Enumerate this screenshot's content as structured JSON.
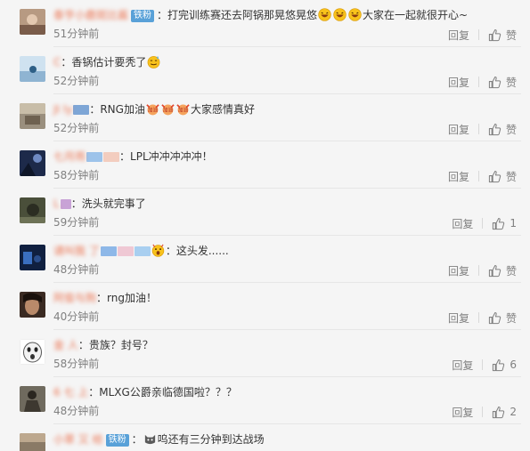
{
  "comments": [
    {
      "nick": "泰亨小鹿斑比酱",
      "badge": "铁粉",
      "text": "：打完训练赛还去阿锅那晃悠晃悠",
      "emojis": [
        "laugh",
        "laugh",
        "laugh"
      ],
      "text2": "大家在一起就很开心~",
      "time": "51分钟前",
      "reply": "回复",
      "like": "赞",
      "likes": ""
    },
    {
      "nick": "C ",
      "badge": "",
      "text": "：香锅估计要秃了",
      "emojis": [
        "sweat"
      ],
      "text2": "",
      "time": "52分钟前",
      "reply": "回复",
      "like": "赞",
      "likes": ""
    },
    {
      "nick": "JI  ly",
      "badge": "",
      "text": "：RNG加油",
      "emojis": [
        "cheer",
        "cheer",
        "cheer"
      ],
      "text2": "大家感情真好",
      "time": "52分钟前",
      "reply": "回复",
      "like": "赞",
      "likes": ""
    },
    {
      "nick": "七月雨",
      "badge": "",
      "text": "：LPL冲冲冲冲冲！",
      "emojis": [],
      "text2": "",
      "time": "58分钟前",
      "reply": "回复",
      "like": "赞",
      "likes": ""
    },
    {
      "nick": "L  ",
      "badge": "",
      "text": "：洗头就完事了",
      "emojis": [],
      "text2": "",
      "time": "59分钟前",
      "reply": "回复",
      "like": "",
      "likes": "1"
    },
    {
      "nick": "请叫我  了",
      "badge": "",
      "text": "：这头发......",
      "emojis": [
        "shock"
      ],
      "text2": "",
      "time": "48分钟前",
      "reply": "回复",
      "like": "赞",
      "likes": ""
    },
    {
      "nick": "阿俊与狗",
      "badge": "",
      "text": "：rng加油！",
      "emojis": [],
      "text2": "",
      "time": "40分钟前",
      "reply": "回复",
      "like": "赞",
      "likes": ""
    },
    {
      "nick": "金  人",
      "badge": "",
      "text": "：贵族？封号？",
      "emojis": [],
      "text2": "",
      "time": "58分钟前",
      "reply": "回复",
      "like": "",
      "likes": "6"
    },
    {
      "nick": "6 七 上",
      "badge": "",
      "text": "：MLXG公爵亲临德国啦？？？",
      "emojis": [],
      "text2": "",
      "time": "48分钟前",
      "reply": "回复",
      "like": "",
      "likes": "2"
    },
    {
      "nick": "小草 又 给",
      "badge": "铁粉",
      "text": "：",
      "emojis": [
        "cat"
      ],
      "text2": "呜还有三分钟到达战场",
      "time": "",
      "reply": "",
      "like": "",
      "likes": ""
    }
  ],
  "colors": {
    "nick": "#eb7350",
    "badge": "#59a1d8",
    "meta": "#808080"
  }
}
